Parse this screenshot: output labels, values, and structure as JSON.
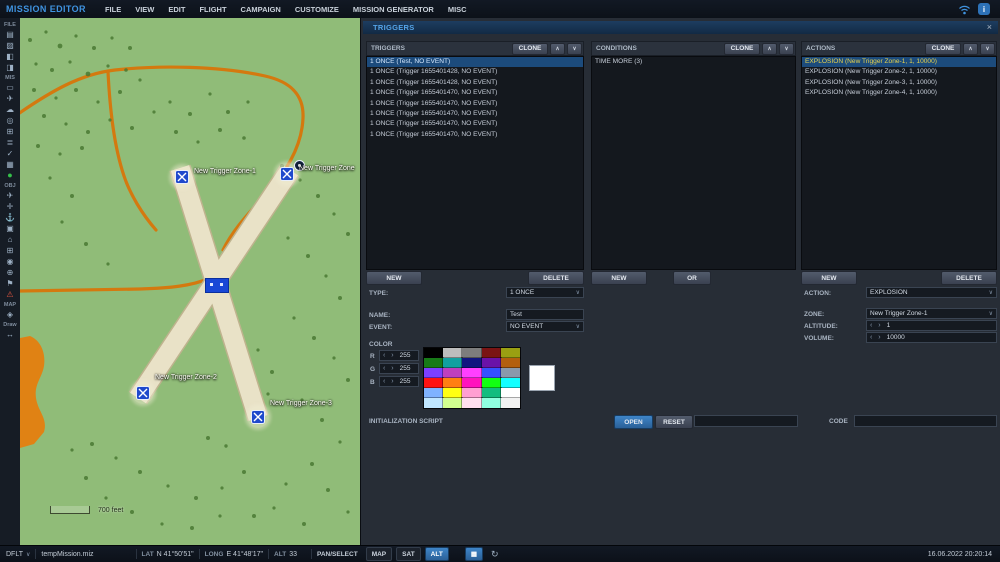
{
  "menu_bar": {
    "title": "MISSION EDITOR",
    "items": [
      "FILE",
      "VIEW",
      "EDIT",
      "FLIGHT",
      "CAMPAIGN",
      "CUSTOMIZE",
      "MISSION GENERATOR",
      "MISC"
    ]
  },
  "toolbar": {
    "sections": {
      "file": "FILE",
      "mis": "MIS",
      "obj": "OBJ",
      "map": "MAP",
      "draw": "Draw"
    },
    "icon_names": [
      "new-mission",
      "open-mission",
      "save-mission",
      "save-as",
      "briefing",
      "payload",
      "weather",
      "goals",
      "rules",
      "lists",
      "check",
      "grid",
      "globe",
      "airplane-group",
      "helicopter-group",
      "ship-group",
      "vehicle-group",
      "static-object",
      "template",
      "zone",
      "waypoint",
      "flag",
      "counter",
      "failures",
      "map-layers",
      "draw-tool",
      "ruler"
    ]
  },
  "map": {
    "zones": [
      {
        "label": "New Trigger Zone-1"
      },
      {
        "label": "New Trigger Zone"
      },
      {
        "label": "New Trigger Zone-2"
      },
      {
        "label": "New Trigger Zone-3"
      }
    ],
    "scale_label": "700 feet"
  },
  "panel": {
    "title": "TRIGGERS",
    "close_icon": "×",
    "triggers": {
      "header": "TRIGGERS",
      "clone_label": "CLONE",
      "new_label": "NEW",
      "delete_label": "DELETE",
      "items": [
        {
          "label": "1 ONCE (Test, NO EVENT)"
        },
        {
          "label": "1 ONCE (Trigger 1655401428, NO EVENT)"
        },
        {
          "label": "1 ONCE (Trigger 1655401428, NO EVENT)"
        },
        {
          "label": "1 ONCE (Trigger 1655401470, NO EVENT)"
        },
        {
          "label": "1 ONCE (Trigger 1655401470, NO EVENT)"
        },
        {
          "label": "1 ONCE (Trigger 1655401470, NO EVENT)"
        },
        {
          "label": "1 ONCE (Trigger 1655401470, NO EVENT)"
        },
        {
          "label": "1 ONCE (Trigger 1655401470, NO EVENT)"
        }
      ]
    },
    "conditions": {
      "header": "CONDITIONS",
      "clone_label": "CLONE",
      "new_label": "NEW",
      "or_label": "OR",
      "items": [
        {
          "label": "TIME MORE (3)"
        }
      ]
    },
    "actions": {
      "header": "ACTIONS",
      "clone_label": "CLONE",
      "new_label": "NEW",
      "delete_label": "DELETE",
      "items": [
        {
          "label": "EXPLOSION (New Trigger Zone-1, 1, 10000)"
        },
        {
          "label": "EXPLOSION (New Trigger Zone-2, 1, 10000)"
        },
        {
          "label": "EXPLOSION (New Trigger Zone-3, 1, 10000)"
        },
        {
          "label": "EXPLOSION (New Trigger Zone-4, 1, 10000)"
        }
      ]
    },
    "trigger_form": {
      "type_label": "TYPE:",
      "type_value": "1 ONCE",
      "name_label": "NAME:",
      "name_value": "Test",
      "event_label": "EVENT:",
      "event_value": "NO EVENT",
      "color_label": "COLOR",
      "r_label": "R",
      "r_value": "255",
      "g_label": "G",
      "g_value": "255",
      "b_label": "B",
      "b_value": "255",
      "selected_color": "#ffffff",
      "palette": [
        "#000000",
        "#bdbdbd",
        "#7d7d7d",
        "#7a1414",
        "#9aa012",
        "#177a17",
        "#12a0a0",
        "#101580",
        "#6a12a8",
        "#b35f0e",
        "#7d3fff",
        "#bf3fbf",
        "#ff3fff",
        "#3550ff",
        "#8a99ab",
        "#ff1212",
        "#ff7f12",
        "#ff12bd",
        "#12ff12",
        "#12ffff",
        "#7fb2ff",
        "#ffff12",
        "#ff9fd2",
        "#12bd7f",
        "#ffffff",
        "#bfe5ff",
        "#d2ff8f",
        "#ffdfef",
        "#8fffdf",
        "#f2f2f2"
      ]
    },
    "action_form": {
      "action_label": "ACTION:",
      "action_value": "EXPLOSION",
      "zone_label": "ZONE:",
      "zone_value": "New Trigger Zone-1",
      "altitude_label": "ALTITUDE:",
      "altitude_value": "1",
      "volume_label": "VOLUME:",
      "volume_value": "10000"
    },
    "init_script": {
      "label": "INITIALIZATION SCRIPT",
      "open_label": "OPEN",
      "reset_label": "RESET",
      "code_label": "CODE",
      "script_value": "",
      "code_value": ""
    }
  },
  "status_bar": {
    "profile": "DFLT",
    "file_name": "tempMission.miz",
    "lat_label": "LAT",
    "lat_value": "N 41°50'51\"",
    "long_label": "LONG",
    "long_value": "E 41°48'17\"",
    "alt_label": "ALT",
    "alt_value": "33",
    "mode_label": "PAN/SELECT",
    "map_label": "MAP",
    "sat_label": "SAT",
    "alt_button_label": "ALT",
    "datetime": "16.06.2022 20:20:14"
  }
}
